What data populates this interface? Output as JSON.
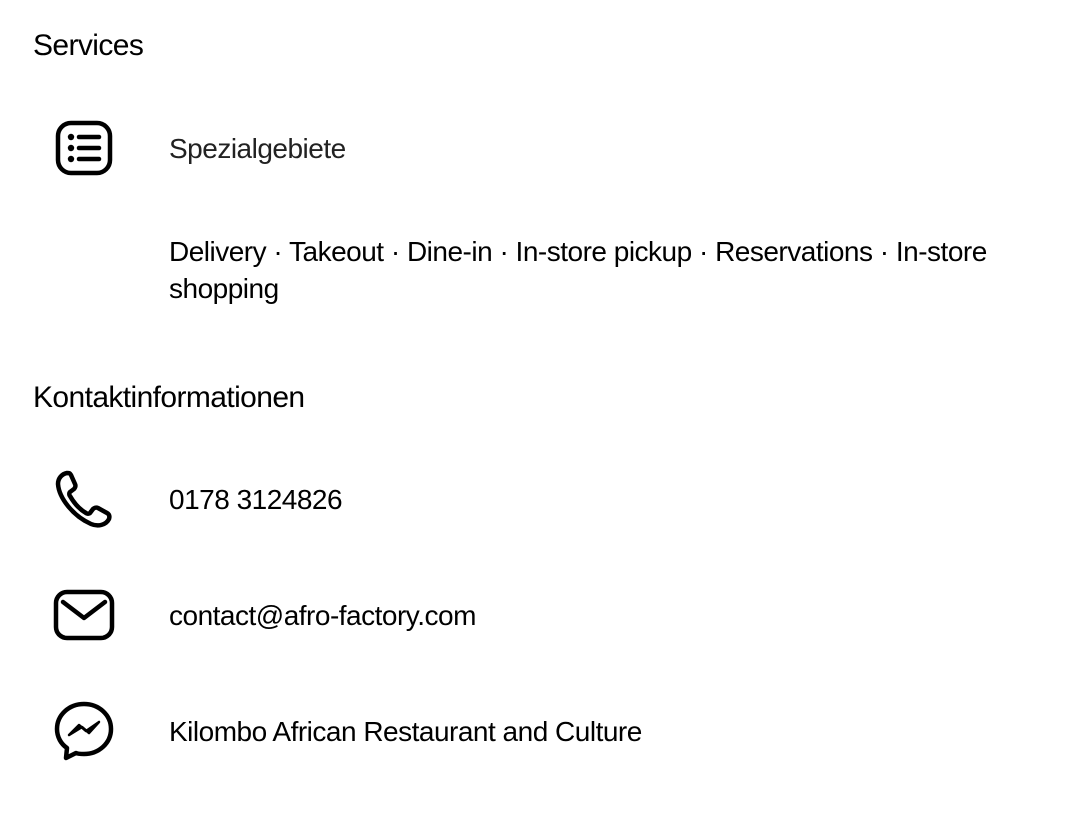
{
  "services": {
    "title": "Services",
    "specialties_label": "Spezialgebiete",
    "specialties_icon": "list-icon",
    "service_list": "Delivery · Takeout · Dine-in · In-store pickup · Reservations · In-store shopping"
  },
  "contact": {
    "title": "Kontaktinformationen",
    "phone": {
      "icon": "phone-icon",
      "value": "0178 3124826"
    },
    "email": {
      "icon": "mail-icon",
      "value": "contact@afro-factory.com"
    },
    "messenger": {
      "icon": "messenger-icon",
      "value": "Kilombo African Restaurant and Culture"
    }
  }
}
